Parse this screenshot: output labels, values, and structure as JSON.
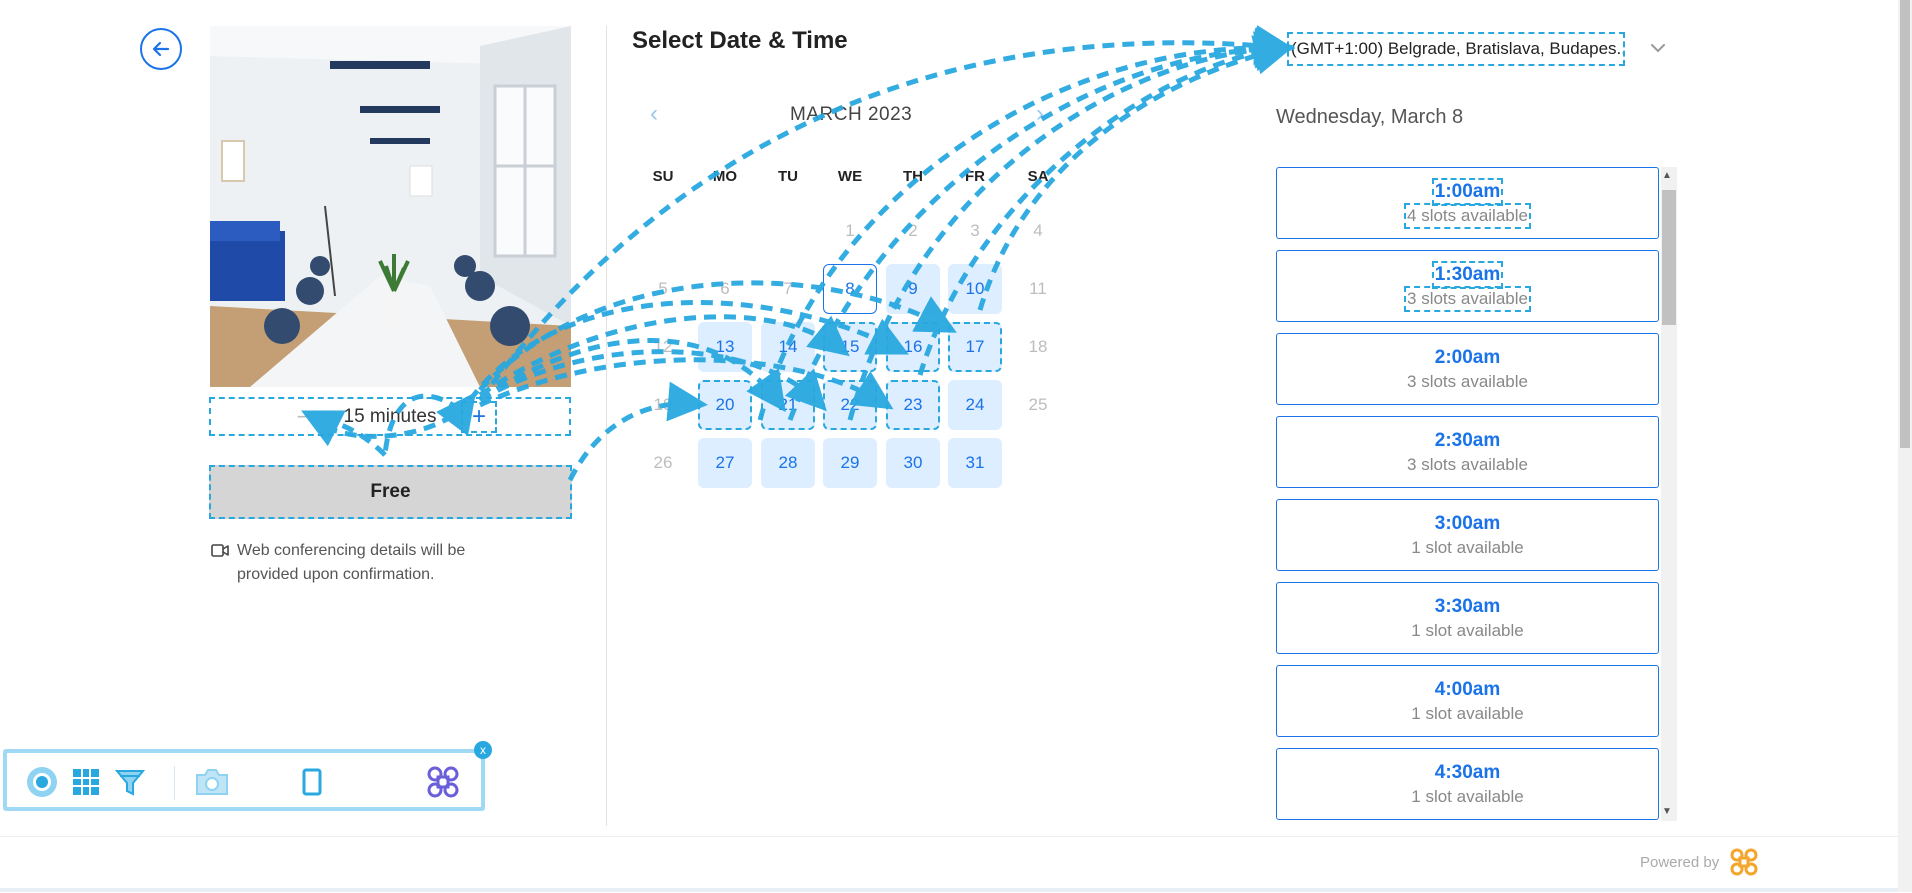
{
  "left_panel": {
    "duration_label": "15 minutes",
    "minus_label": "−",
    "plus_label": "+",
    "price_label": "Free",
    "conference_note": "Web conferencing details will be provided upon confirmation."
  },
  "scheduler": {
    "title": "Select Date & Time",
    "month_label": "MARCH 2023",
    "prev_label": "‹",
    "next_label": "›",
    "weekdays": [
      "SU",
      "MO",
      "TU",
      "WE",
      "TH",
      "FR",
      "SA"
    ],
    "timezone": "(GMT+1:00) Belgrade, Bratislava, Budapes...",
    "selected_date_label": "Wednesday, March 8"
  },
  "calendar": {
    "rows": [
      [
        null,
        null,
        null,
        1,
        2,
        3,
        4
      ],
      [
        5,
        6,
        7,
        8,
        9,
        10,
        11
      ],
      [
        12,
        13,
        14,
        15,
        16,
        17,
        18
      ],
      [
        19,
        20,
        21,
        22,
        23,
        24,
        25
      ],
      [
        26,
        27,
        28,
        29,
        30,
        31,
        null
      ]
    ],
    "available": [
      8,
      9,
      10,
      13,
      14,
      15,
      16,
      17,
      20,
      21,
      22,
      23,
      24,
      27,
      28,
      29,
      30,
      31
    ],
    "selected": 8,
    "dashed": [
      15,
      16,
      17,
      20,
      21,
      22,
      23
    ]
  },
  "slots": [
    {
      "time": "1:00am",
      "availability": "4 slots available",
      "dashed": true
    },
    {
      "time": "1:30am",
      "availability": "3 slots available",
      "dashed": true
    },
    {
      "time": "2:00am",
      "availability": "3 slots available"
    },
    {
      "time": "2:30am",
      "availability": "3 slots available"
    },
    {
      "time": "3:00am",
      "availability": "1 slot available"
    },
    {
      "time": "3:30am",
      "availability": "1 slot available"
    },
    {
      "time": "4:00am",
      "availability": "1 slot available"
    },
    {
      "time": "4:30am",
      "availability": "1 slot available"
    }
  ],
  "footer": {
    "powered_by": "Powered by"
  },
  "toolbar": {
    "close_label": "x"
  },
  "colors": {
    "accent": "#1a73e8",
    "available_bg": "#dceeff",
    "dash": "#29a8e0",
    "toolbar_border": "#9fd9f3",
    "brand_orange": "#f4a52b",
    "toolbar_purple": "#6a5fd8"
  }
}
